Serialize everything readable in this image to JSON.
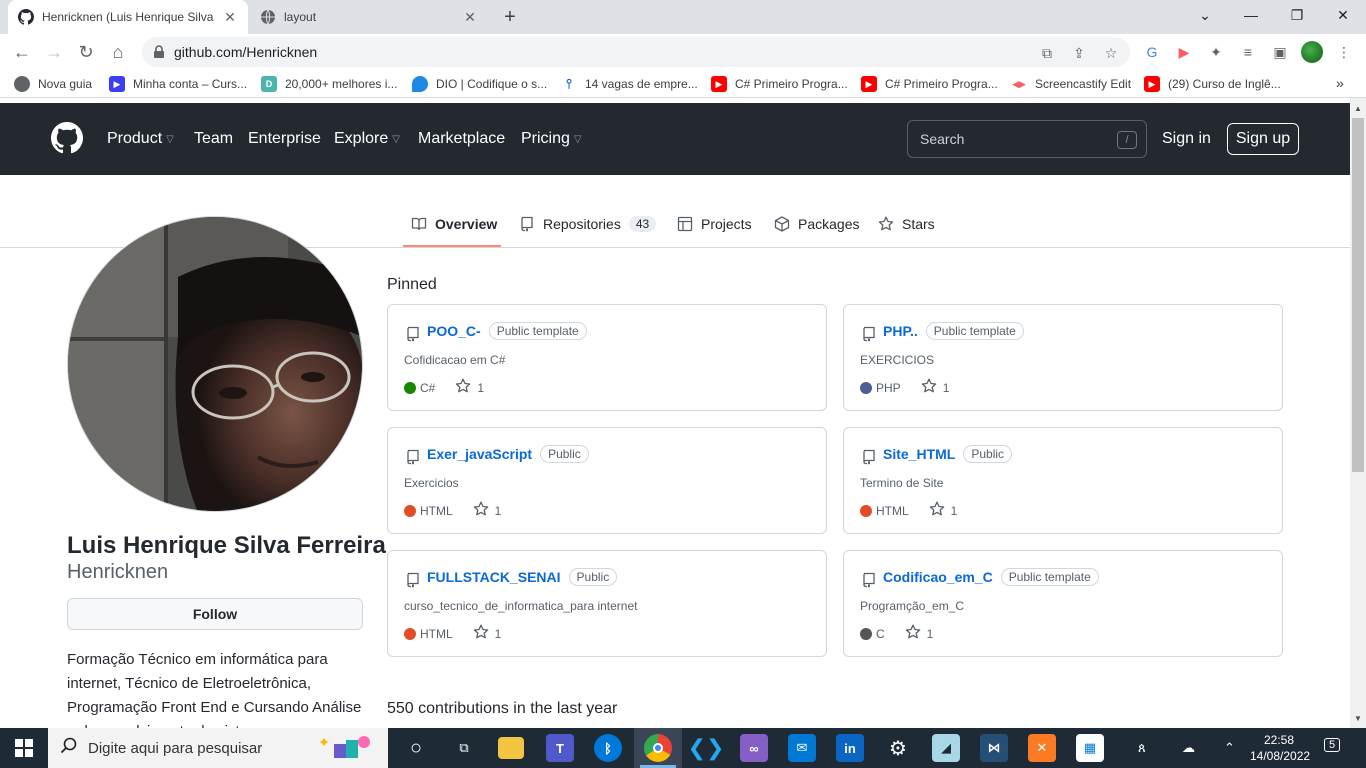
{
  "browser": {
    "tabs": [
      {
        "title": "Henricknen (Luis Henrique Silva F",
        "active": true,
        "icon": "github-icon"
      },
      {
        "title": "layout",
        "active": false,
        "icon": "globe-icon"
      }
    ],
    "url": "github.com/Henricknen",
    "bookmarks": [
      {
        "label": "Nova guia",
        "color": "#5f6368"
      },
      {
        "label": "Minha conta – Curs...",
        "color": "#3d3df5"
      },
      {
        "label": "20,000+ melhores i...",
        "color": "#4db6ac"
      },
      {
        "label": "DIO | Codifique o s...",
        "color": "#1e88e5"
      },
      {
        "label": "14 vagas de empre...",
        "color": "#1565c0"
      },
      {
        "label": "C# Primeiro Progra...",
        "color": "#ff0000"
      },
      {
        "label": "C# Primeiro Progra...",
        "color": "#ff0000"
      },
      {
        "label": "Screencastify Edit",
        "color": "#ff5a5f"
      },
      {
        "label": "(29) Curso de Inglê...",
        "color": "#ff0000"
      }
    ]
  },
  "header": {
    "nav": [
      {
        "label": "Product",
        "dropdown": true
      },
      {
        "label": "Team",
        "dropdown": false
      },
      {
        "label": "Enterprise",
        "dropdown": false
      },
      {
        "label": "Explore",
        "dropdown": true
      },
      {
        "label": "Marketplace",
        "dropdown": false
      },
      {
        "label": "Pricing",
        "dropdown": true
      }
    ],
    "search_placeholder": "Search",
    "search_shortcut": "/",
    "sign_in": "Sign in",
    "sign_up": "Sign up"
  },
  "profile_tabs": [
    {
      "label": "Overview",
      "icon": "book-icon",
      "selected": true
    },
    {
      "label": "Repositories",
      "icon": "repo-icon",
      "count": "43"
    },
    {
      "label": "Projects",
      "icon": "table-icon"
    },
    {
      "label": "Packages",
      "icon": "package-icon"
    },
    {
      "label": "Stars",
      "icon": "star-icon"
    }
  ],
  "profile": {
    "full_name": "Luis Henrique Silva Ferreira",
    "username": "Henricknen",
    "follow_label": "Follow",
    "bio": "Formação Técnico em informática para internet, Técnico de Eletroeletrônica, Programação Front End e Cursando Análise e desenvolvimento de sistemas"
  },
  "pinned": {
    "title": "Pinned",
    "repos": [
      {
        "name": "POO_C-",
        "visibility": "Public template",
        "description": "Cofidicacao em C#",
        "language": "C#",
        "lang_color": "#178600",
        "stars": "1"
      },
      {
        "name": "PHP..",
        "visibility": "Public template",
        "description": "EXERCICIOS",
        "language": "PHP",
        "lang_color": "#4F5D95",
        "stars": "1"
      },
      {
        "name": "Exer_javaScript",
        "visibility": "Public",
        "description": "Exercicios",
        "language": "HTML",
        "lang_color": "#e34c26",
        "stars": "1"
      },
      {
        "name": "Site_HTML",
        "visibility": "Public",
        "description": "Termino de Site",
        "language": "HTML",
        "lang_color": "#e34c26",
        "stars": "1"
      },
      {
        "name": "FULLSTACK_SENAI",
        "visibility": "Public",
        "description": "curso_tecnico_de_informatica_para internet",
        "language": "HTML",
        "lang_color": "#e34c26",
        "stars": "1"
      },
      {
        "name": "Codificao_em_C",
        "visibility": "Public template",
        "description": "Programção_em_C",
        "language": "C",
        "lang_color": "#555555",
        "stars": "1"
      }
    ]
  },
  "contributions": "550 contributions in the last year",
  "taskbar": {
    "search_placeholder": "Digite aqui para pesquisar",
    "time": "22:58",
    "date": "14/08/2022",
    "notifications": "5"
  }
}
